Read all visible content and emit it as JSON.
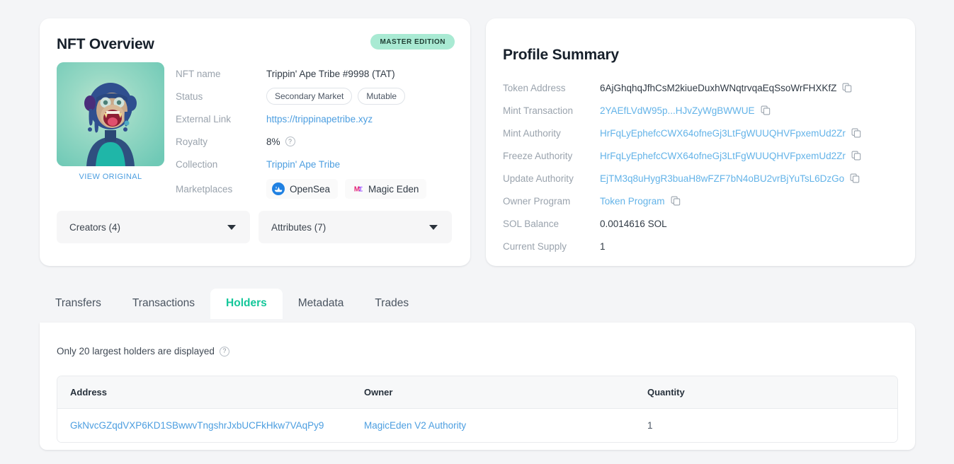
{
  "nft_overview": {
    "title": "NFT Overview",
    "badge": "MASTER EDITION",
    "view_original": "VIEW ORIGINAL",
    "rows": {
      "nft_name_label": "NFT name",
      "nft_name_value": "Trippin' Ape Tribe #9998 (TAT)",
      "status_label": "Status",
      "status_pills": [
        "Secondary Market",
        "Mutable"
      ],
      "external_link_label": "External Link",
      "external_link_value": "https://trippinapetribe.xyz",
      "royalty_label": "Royalty",
      "royalty_value": "8%",
      "collection_label": "Collection",
      "collection_value": "Trippin' Ape Tribe",
      "marketplaces_label": "Marketplaces",
      "marketplaces": [
        {
          "name": "OpenSea",
          "icon": "opensea-icon"
        },
        {
          "name": "Magic Eden",
          "icon": "magic-eden-icon"
        }
      ]
    },
    "dropdowns": [
      {
        "label": "Creators (4)",
        "name": "creators"
      },
      {
        "label": "Attributes (7)",
        "name": "attributes"
      }
    ]
  },
  "profile_summary": {
    "title": "Profile Summary",
    "rows": [
      {
        "label": "Token Address",
        "value": "6AjGhqhqJfhCsM2kiueDuxhWNqtrvqaEqSsoWrFHXKfZ",
        "link": false,
        "copy": true
      },
      {
        "label": "Mint Transaction",
        "value": "2YAEfLVdW95p...HJvZyWgBWWUE",
        "link": true,
        "copy": true
      },
      {
        "label": "Mint Authority",
        "value": "HrFqLyEphefcCWX64ofneGj3LtFgWUUQHVFpxemUd2Zr",
        "link": true,
        "copy": true
      },
      {
        "label": "Freeze Authority",
        "value": "HrFqLyEphefcCWX64ofneGj3LtFgWUUQHVFpxemUd2Zr",
        "link": true,
        "copy": true
      },
      {
        "label": "Update Authority",
        "value": "EjTM3q8uHygR3buaH8wFZF7bN4oBU2vrBjYuTsL6DzGo",
        "link": true,
        "copy": true
      },
      {
        "label": "Owner Program",
        "value": "Token Program",
        "link": true,
        "copy": true
      },
      {
        "label": "SOL Balance",
        "value": "0.0014616 SOL",
        "link": false,
        "copy": false
      },
      {
        "label": "Current Supply",
        "value": "1",
        "link": false,
        "copy": false
      }
    ]
  },
  "tabs": [
    {
      "label": "Transfers",
      "active": false
    },
    {
      "label": "Transactions",
      "active": false
    },
    {
      "label": "Holders",
      "active": true
    },
    {
      "label": "Metadata",
      "active": false
    },
    {
      "label": "Trades",
      "active": false
    }
  ],
  "holders": {
    "note": "Only 20 largest holders are displayed",
    "columns": [
      "Address",
      "Owner",
      "Quantity"
    ],
    "rows": [
      {
        "address": "GkNvcGZqdVXP6KD1SBwwvTngshrJxbUCFkHkw7VAqPy9",
        "owner": "MagicEden V2 Authority",
        "quantity": "1"
      }
    ]
  },
  "colors": {
    "accent": "#14c79a",
    "link": "#4c9ee0",
    "badge_bg": "#a9ead3",
    "page_bg": "#f4f5f7"
  }
}
